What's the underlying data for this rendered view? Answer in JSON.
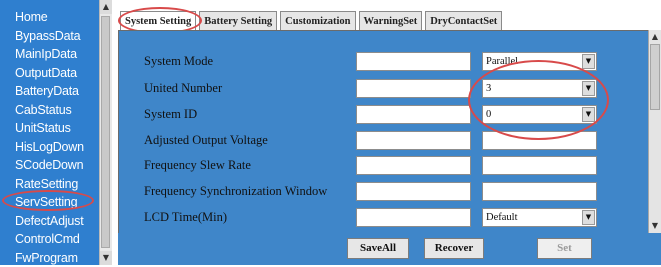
{
  "nav": {
    "items": [
      {
        "label": "Home"
      },
      {
        "label": "BypassData"
      },
      {
        "label": "MainIpData"
      },
      {
        "label": "OutputData"
      },
      {
        "label": "BatteryData"
      },
      {
        "label": "CabStatus"
      },
      {
        "label": "UnitStatus"
      },
      {
        "label": "HisLogDown"
      },
      {
        "label": "SCodeDown"
      },
      {
        "label": "RateSetting"
      },
      {
        "label": "ServSetting"
      },
      {
        "label": "DefectAdjust"
      },
      {
        "label": "ControlCmd"
      },
      {
        "label": "FwProgram"
      }
    ],
    "highlighted": "ServSetting"
  },
  "tabs": [
    {
      "label": "System Setting",
      "active": true
    },
    {
      "label": "Battery Setting",
      "active": false
    },
    {
      "label": "Customization",
      "active": false
    },
    {
      "label": "WarningSet",
      "active": false
    },
    {
      "label": "DryContactSet",
      "active": false
    }
  ],
  "settings": [
    {
      "label": "System Mode",
      "value": "",
      "option": "Parallel",
      "dropdown": true
    },
    {
      "label": "United Number",
      "value": "",
      "option": "3",
      "dropdown": true
    },
    {
      "label": "System ID",
      "value": "",
      "option": "0",
      "dropdown": true
    },
    {
      "label": "Adjusted Output Voltage",
      "value": "",
      "option": "",
      "dropdown": false
    },
    {
      "label": "Frequency Slew Rate",
      "value": "",
      "option": "",
      "dropdown": false
    },
    {
      "label": "Frequency Synchronization Window",
      "value": "",
      "option": "",
      "dropdown": false
    },
    {
      "label": "LCD Time(Min)",
      "value": "",
      "option": "Default",
      "dropdown": true
    }
  ],
  "footer": {
    "save_all": "SaveAll",
    "recover": "Recover",
    "set": "Set"
  },
  "icons": {
    "scroll_up": "up-arrow-icon",
    "scroll_down": "down-arrow-icon",
    "dropdown": "chevron-down-icon"
  },
  "colors": {
    "panel": "#3f86c9",
    "nav": "#2f7fcf",
    "annotation": "#d84a4a"
  }
}
